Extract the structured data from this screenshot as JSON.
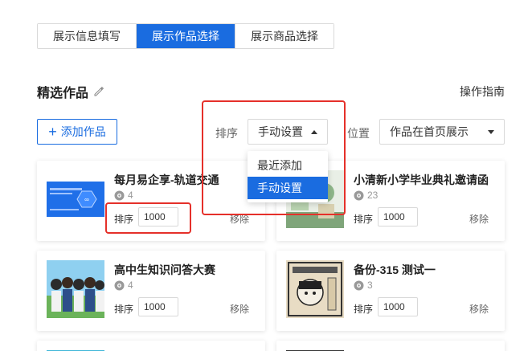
{
  "tabs": [
    {
      "label": "展示信息填写",
      "active": false
    },
    {
      "label": "展示作品选择",
      "active": true
    },
    {
      "label": "展示商品选择",
      "active": false
    }
  ],
  "section": {
    "title": "精选作品",
    "edit_icon": "pencil-icon"
  },
  "guide_link": "操作指南",
  "add_button": {
    "label": "添加作品",
    "icon": "plus-icon"
  },
  "sort": {
    "label": "排序",
    "value": "手动设置",
    "options": [
      "最近添加",
      "手动设置"
    ],
    "selected_index": 1
  },
  "position": {
    "label": "位置",
    "value": "作品在首页展示"
  },
  "cards": [
    {
      "title": "每月易企享-轨道交通",
      "views": "4",
      "order_label": "排序",
      "order": "1000",
      "remove": "移除"
    },
    {
      "title": "小清新小学毕业典礼邀请函",
      "views": "23",
      "order_label": "排序",
      "order": "1000",
      "remove": "移除"
    },
    {
      "title": "高中生知识问答大赛",
      "views": "4",
      "order_label": "排序",
      "order": "1000",
      "remove": "移除"
    },
    {
      "title": "备份-315 测试一",
      "views": "3",
      "order_label": "排序",
      "order": "1000",
      "remove": "移除"
    }
  ],
  "colors": {
    "primary": "#1a6ce0",
    "highlight": "#e5302a"
  }
}
